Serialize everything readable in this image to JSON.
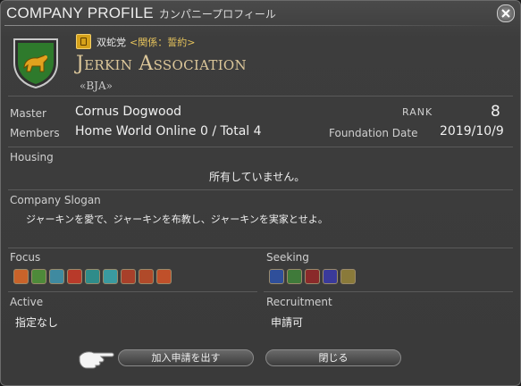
{
  "window": {
    "title_en": "COMPANY PROFILE",
    "title_jp": "カンパニープロフィール"
  },
  "grand_company": {
    "name": "双蛇党",
    "relation": "<関係：誓約>"
  },
  "company": {
    "name": "Jerkin Association",
    "tag": "«BJA»"
  },
  "details": {
    "master_label": "Master",
    "master": "Cornus Dogwood",
    "members_label": "Members",
    "members": "Home World Online 0 / Total 4",
    "rank_label": "RANK",
    "rank": "8",
    "foundation_label": "Foundation Date",
    "foundation": "2019/10/9"
  },
  "housing": {
    "label": "Housing",
    "value": "所有していません。"
  },
  "slogan": {
    "label": "Company Slogan",
    "value": "ジャーキンを愛で、ジャーキンを布教し、ジャーキンを実家とせよ。"
  },
  "focus": {
    "label": "Focus",
    "icons": [
      "role-playing-icon",
      "leveling-icon",
      "casual-icon",
      "hardcore-icon",
      "dungeons-icon",
      "guildhests-icon",
      "trials-icon",
      "raids-icon",
      "pvp-icon"
    ]
  },
  "seeking": {
    "label": "Seeking",
    "icons": [
      "tank-icon",
      "healer-icon",
      "dps-icon",
      "crafter-icon",
      "gatherer-icon"
    ]
  },
  "active": {
    "label": "Active",
    "value": "指定なし"
  },
  "recruitment": {
    "label": "Recruitment",
    "value": "申請可"
  },
  "buttons": {
    "apply": "加入申請を出す",
    "close": "閉じる"
  },
  "colors": {
    "accent_gold": "#dcc79a",
    "relation_gold": "#e6c35c"
  }
}
